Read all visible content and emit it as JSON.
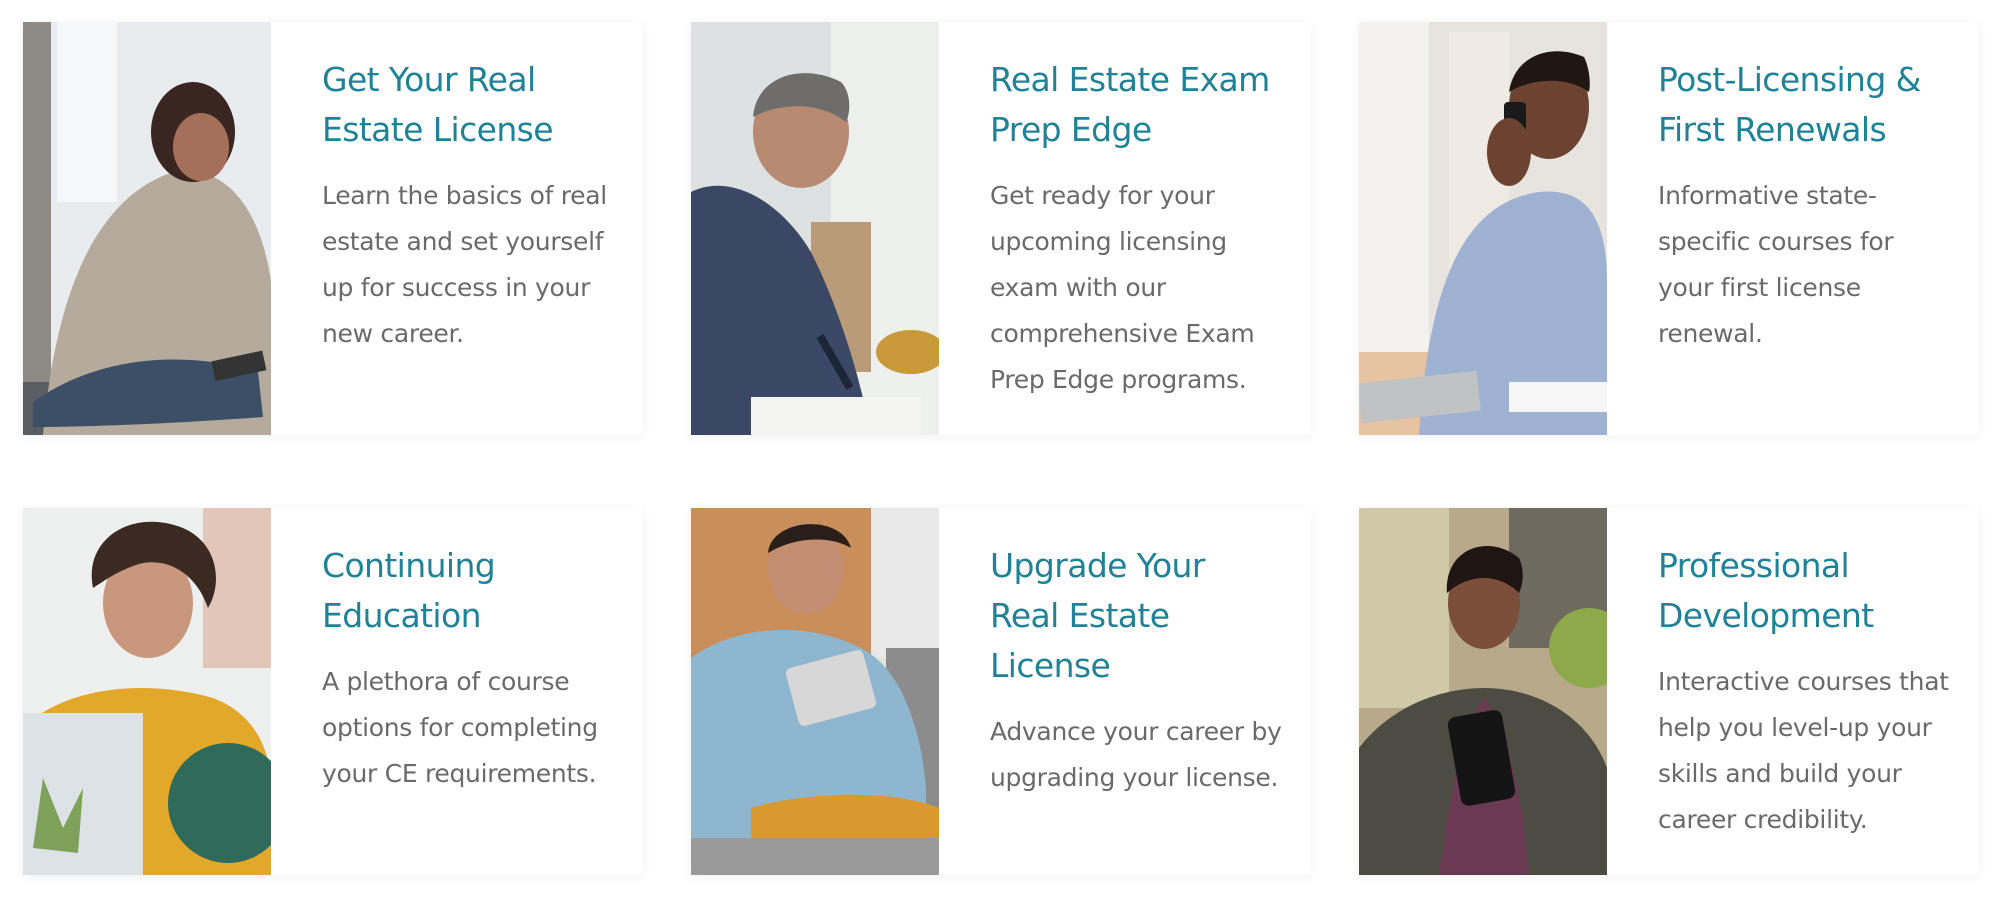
{
  "cards": [
    {
      "title": "Get Your Real Estate License",
      "description": "Learn the basics of real estate and set yourself up for success in your new career."
    },
    {
      "title": "Real Estate Exam Prep Edge",
      "description": "Get ready for your upcoming licensing exam with our comprehensive Exam Prep Edge programs."
    },
    {
      "title": "Post-Licensing & First Renewals",
      "description": "Informative state-specific courses for your first license renewal."
    },
    {
      "title": "Continuing Education",
      "description": "A plethora of course options for completing your CE requirements."
    },
    {
      "title": "Upgrade Your Real Estate License",
      "description": "Advance your career by upgrading your license."
    },
    {
      "title": "Professional Development",
      "description": "Interactive courses that help you level-up your skills and build your career credibility."
    }
  ],
  "colors": {
    "title": "#1f8297",
    "text": "#6a6a6a",
    "background": "#ffffff"
  }
}
